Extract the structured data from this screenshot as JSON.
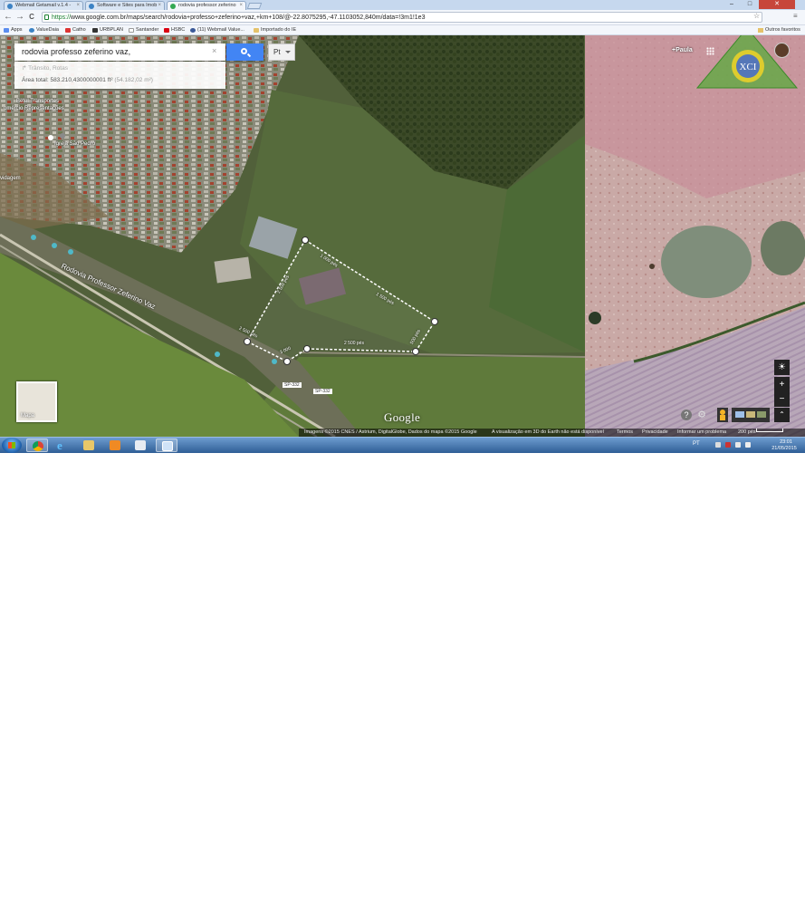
{
  "browser": {
    "tabs": [
      {
        "label": "Webmail Getamail v.1.4 - ",
        "color": "#3b82c4"
      },
      {
        "label": "Software e Sites para Imob",
        "color": "#3b82c4"
      },
      {
        "label": "rodovia professor zeferino",
        "color": "#34a853"
      }
    ],
    "new_tab_icon": "new-tab-icon",
    "window_controls": {
      "minimize": "–",
      "maximize": "□",
      "close": "✕"
    },
    "nav": {
      "back": "←",
      "forward": "→",
      "reload": "C"
    },
    "url": {
      "scheme": "https://",
      "rest": "www.google.com.br/maps/search/rodovia+professo+zeferino+vaz,+km+108/@-22.8075295,-47.1103052,840m/data=!3m1!1e3"
    },
    "bookmarks": [
      {
        "label": "Apps",
        "color": "#5b8def"
      },
      {
        "label": "ValueDaia",
        "color": "#3b82c4"
      },
      {
        "label": "Catho",
        "color": "#d33"
      },
      {
        "label": "URBPLAN",
        "color": "#333"
      },
      {
        "label": "Santander",
        "color": "#999"
      },
      {
        "label": "HSBC",
        "color": "#db0011"
      },
      {
        "label": "(11) Webmail Value...",
        "color": "#3b5998"
      },
      {
        "label": "Importado do IE",
        "color": "#e5c26b"
      }
    ],
    "bookmarks_other": "Outros favoritos"
  },
  "search": {
    "query": "rodovia professo zeferino vaz,",
    "clear": "×",
    "lang_button": "Pt",
    "traffic_label": "Trânsito, Rotas",
    "area_label": "Área total:",
    "area_value": "583.210,4300000001 ft²",
    "area_secondary": "(54.182,02 m²)"
  },
  "account": {
    "user": "+Paula"
  },
  "map": {
    "labels": {
      "betel": "Betel Transportes",
      "comercio": "omércio Representações",
      "igreja": "Igreja São Pedro",
      "vidagrem": "vidagem",
      "road": "Rodovia Professor Zeferino Vaz",
      "sp332_a": "SP-332",
      "sp332_b": "SP-332"
    },
    "measurements": {
      "m1": "1 000 pés",
      "m2": "1 500 pés",
      "m3": "2 500 pés",
      "m4": "500 pés",
      "m5": "2 500 pés",
      "m6": "2 500 pés",
      "m7": "3 000"
    },
    "thumbnail_label": "Mapa",
    "google_logo": "Google",
    "controls": {
      "compass": "☀",
      "zoom_in": "+",
      "zoom_out": "−",
      "help": "?",
      "settings": "⚙",
      "expand": "⌃"
    },
    "attribution": {
      "imagery": "Imagens ©2015 CNES / Astrium, DigitalGlobe, Dados do mapa ©2015 Google",
      "earth_notice": "A visualização em 3D do Earth não está disponível",
      "terms": "Termos",
      "privacy": "Privacidade",
      "report": "Informar um problema",
      "scale": "200 pés"
    }
  },
  "watermark": {
    "text": "XCI"
  },
  "taskbar": {
    "items": [
      "start-button",
      "chrome-icon",
      "ie-icon",
      "explorer-icon",
      "media-icon",
      "document-icon",
      "picture-icon"
    ],
    "language": "PT",
    "time": "23:01",
    "date": "21/05/2015"
  },
  "colors": {
    "accent": "#4285f4",
    "measure_line": "#ffffff",
    "taskbar": "#2f5e96",
    "close_button": "#c7463b"
  }
}
